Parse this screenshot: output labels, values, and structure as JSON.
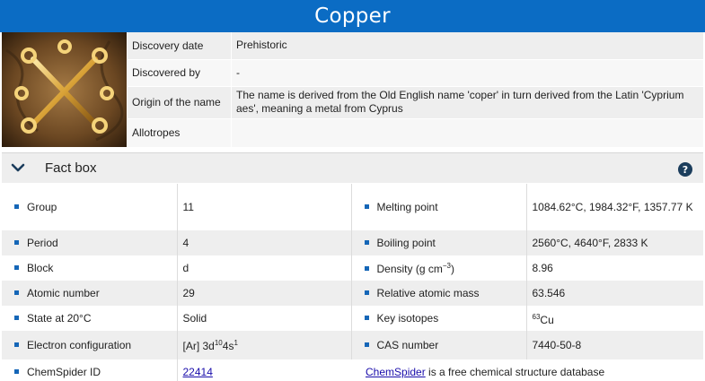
{
  "element": {
    "name": "Copper",
    "image_icon": "alchemical-copper-symbol-icon"
  },
  "info": [
    {
      "label": "Discovery date",
      "value": "Prehistoric"
    },
    {
      "label": "Discovered by",
      "value": "-"
    },
    {
      "label": "Origin of the name",
      "value": "The name is derived from the Old English name 'coper' in turn derived from the Latin 'Cyprium aes', meaning a metal from Cyprus"
    },
    {
      "label": "Allotropes",
      "value": ""
    }
  ],
  "factbox": {
    "title": "Fact box",
    "help": "?",
    "group": {
      "label": "Group",
      "value": "11"
    },
    "melting_point": {
      "label": "Melting point",
      "value": "1084.62°C, 1984.32°F, 1357.77 K"
    },
    "period": {
      "label": "Period",
      "value": "4"
    },
    "boiling_point": {
      "label": "Boiling point",
      "value": "2560°C, 4640°F, 2833 K"
    },
    "block": {
      "label": "Block",
      "value": "d"
    },
    "density": {
      "label_text": "Density (g cm",
      "label_sup": "−3",
      "label_end": ")",
      "value": "8.96"
    },
    "atomic_number": {
      "label": "Atomic number",
      "value": "29"
    },
    "relative_atomic_mass": {
      "label": "Relative atomic mass",
      "value": "63.546"
    },
    "state": {
      "label": "State at 20°C",
      "value": "Solid"
    },
    "key_isotopes": {
      "label": "Key isotopes",
      "value_sup": "63",
      "value": "Cu"
    },
    "electron_configuration": {
      "label": "Electron configuration",
      "value_pre": "[Ar] 3d",
      "sup1": "10",
      "mid": "4s",
      "sup2": "1"
    },
    "cas_number": {
      "label": "CAS number",
      "value": "7440-50-8"
    },
    "chemspider": {
      "label": "ChemSpider ID",
      "id": "22414",
      "link_text": "ChemSpider",
      "note": " is a free chemical structure database"
    }
  }
}
